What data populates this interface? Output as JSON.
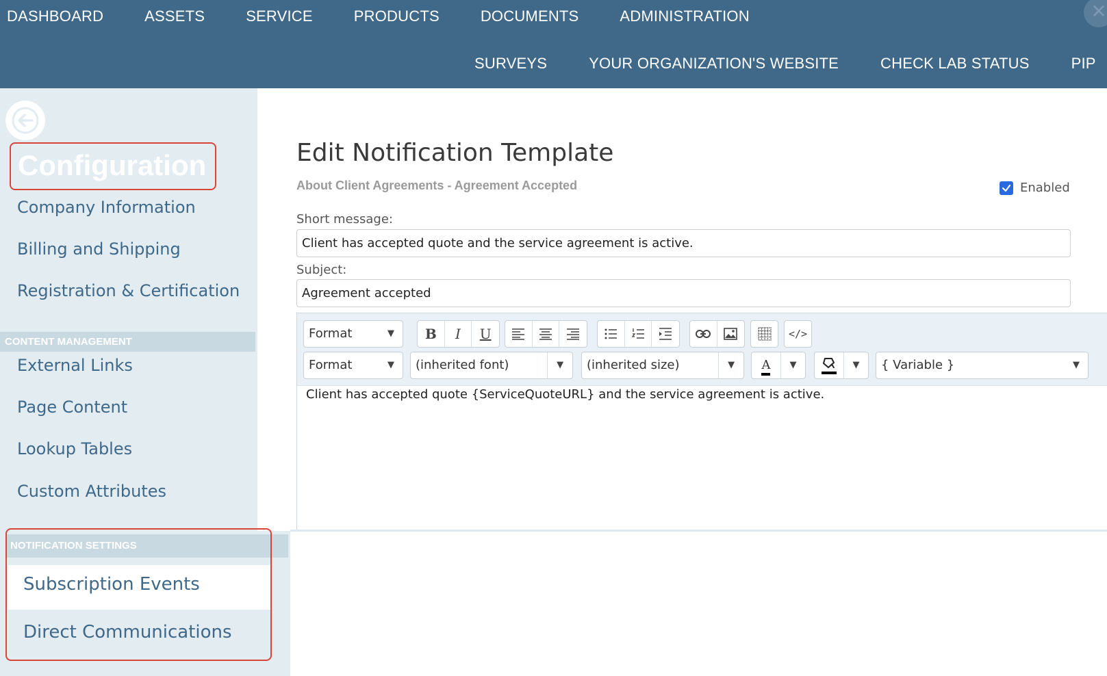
{
  "nav": {
    "row1": [
      "DASHBOARD",
      "ASSETS",
      "SERVICE",
      "PRODUCTS",
      "DOCUMENTS",
      "ADMINISTRATION"
    ],
    "row2": [
      "SURVEYS",
      "YOUR ORGANIZATION'S WEBSITE",
      "CHECK LAB STATUS",
      "PIP"
    ]
  },
  "sidebar": {
    "title": "Configuration",
    "top_links": [
      "Company Information",
      "Billing and Shipping",
      "Registration & Certification"
    ],
    "content_section": "CONTENT MANAGEMENT",
    "content_links": [
      "External Links",
      "Page Content",
      "Lookup Tables",
      "Custom Attributes"
    ],
    "notification_section": "NOTIFICATION SETTINGS",
    "notification_links": [
      "Subscription Events",
      "Direct Communications"
    ]
  },
  "main": {
    "title": "Edit Notification Template",
    "subtitle": "About Client Agreements - Agreement Accepted",
    "enabled_label": "Enabled",
    "enabled": true,
    "short_message_label": "Short message:",
    "short_message_value": "Client has accepted quote and the service agreement is active.",
    "subject_label": "Subject:",
    "subject_value": "Agreement accepted"
  },
  "editor": {
    "format1": "Format",
    "format2": "Format",
    "font": "(inherited font)",
    "size": "(inherited size)",
    "variable": "{ Variable }",
    "body": "Client has accepted quote {ServiceQuoteURL} and the service agreement is active.",
    "icons": [
      "bold-icon",
      "italic-icon",
      "underline-icon",
      "align-left-icon",
      "align-center-icon",
      "align-right-icon",
      "bullet-list-icon",
      "numbered-list-icon",
      "indent-icon",
      "link-icon",
      "image-icon",
      "table-icon",
      "source-code-icon",
      "text-color-icon",
      "highlight-icon"
    ]
  },
  "colors": {
    "topbar": "#3f6889",
    "sidebar": "#e2ecf1",
    "section": "#c9d9e2",
    "highlight_border": "#d9443a",
    "checkbox": "#2a6ae0"
  }
}
